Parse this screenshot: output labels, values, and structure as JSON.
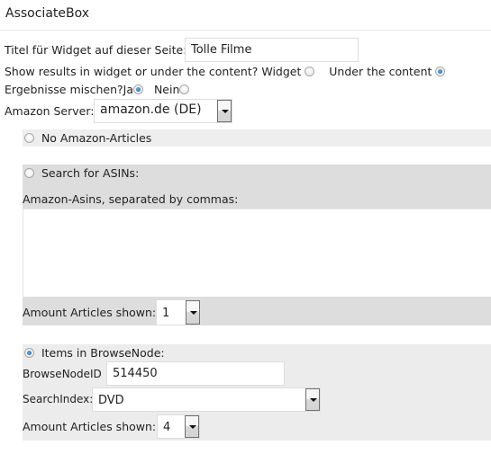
{
  "header": {
    "title": "AssociateBox"
  },
  "widget_title": {
    "label": "Titel für Widget auf dieser Seite:",
    "value": "Tolle Filme"
  },
  "display_location": {
    "label": "Show results in widget or under the content?",
    "options": [
      {
        "label": "Widget",
        "selected": false
      },
      {
        "label": "Under the content",
        "selected": true
      }
    ]
  },
  "mix_results": {
    "label": "Ergebnisse mischen?",
    "options": [
      {
        "label": "Ja",
        "selected": true
      },
      {
        "label": "Nein",
        "selected": false
      }
    ]
  },
  "amazon_server": {
    "label": "Amazon Server:",
    "value": "amazon.de (DE)"
  },
  "no_articles": {
    "label": "No Amazon-Articles",
    "selected": false
  },
  "asin_search": {
    "label": "Search for ASINs:",
    "selected": false,
    "asins_label": "Amazon-Asins, separated by commas:",
    "asins_value": "",
    "amount_label": "Amount Articles shown:",
    "amount_value": "1"
  },
  "browse_node": {
    "label": "Items in BrowseNode:",
    "selected": true,
    "node_id_label": "BrowseNodeID",
    "node_id_value": "514450",
    "search_index_label": "SearchIndex:",
    "search_index_value": "DVD",
    "amount_label": "Amount Articles shown:",
    "amount_value": "4"
  }
}
